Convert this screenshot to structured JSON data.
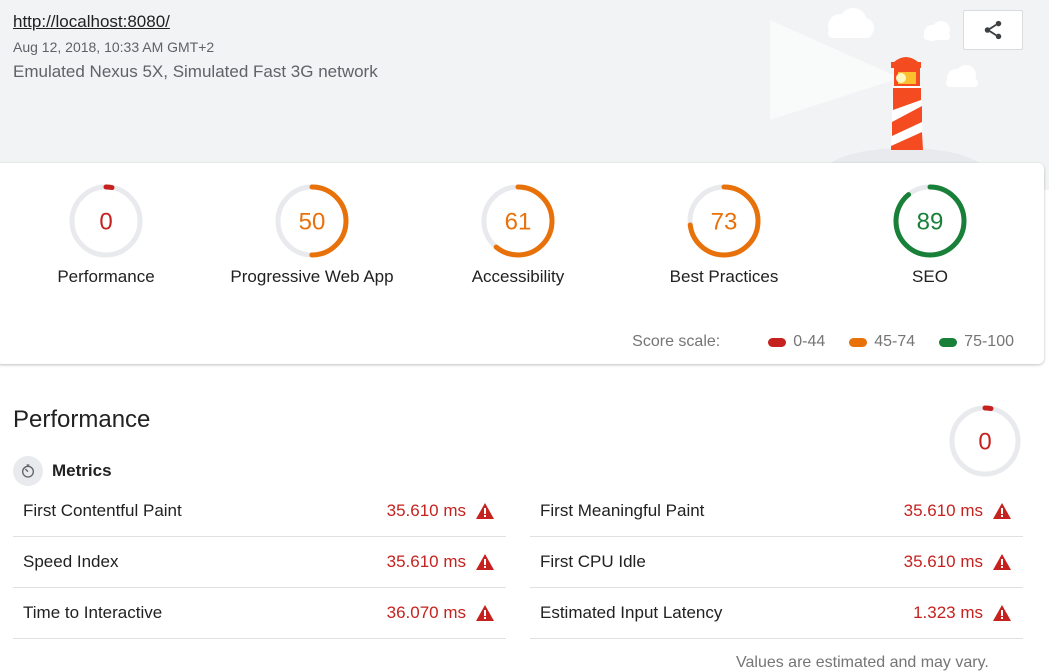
{
  "header": {
    "url": "http://localhost:8080/",
    "timestamp": "Aug 12, 2018, 10:33 AM GMT+2",
    "environment": "Emulated Nexus 5X, Simulated Fast 3G network",
    "share_icon": "share-icon"
  },
  "colors": {
    "fail": "#c5221f",
    "average": "#e8710a",
    "pass": "#188038",
    "track": "#e8eaed"
  },
  "gauges": [
    {
      "label": "Performance",
      "score": "0",
      "fraction": 0.0,
      "rating": "fail"
    },
    {
      "label": "Progressive Web App",
      "score": "50",
      "fraction": 0.5,
      "rating": "average"
    },
    {
      "label": "Accessibility",
      "score": "61",
      "fraction": 0.61,
      "rating": "average"
    },
    {
      "label": "Best Practices",
      "score": "73",
      "fraction": 0.73,
      "rating": "average"
    },
    {
      "label": "SEO",
      "score": "89",
      "fraction": 0.89,
      "rating": "pass"
    }
  ],
  "score_scale": {
    "title": "Score scale:",
    "ranges": [
      {
        "label": "0-44",
        "rating": "fail"
      },
      {
        "label": "45-74",
        "rating": "average"
      },
      {
        "label": "75-100",
        "rating": "pass"
      }
    ]
  },
  "performance": {
    "title": "Performance",
    "score": "0",
    "fraction": 0.0,
    "metrics_label": "Metrics",
    "metrics_icon": "stopwatch-icon",
    "left_metrics": [
      {
        "name": "First Contentful Paint",
        "value": "35.610 ms"
      },
      {
        "name": "Speed Index",
        "value": "35.610 ms"
      },
      {
        "name": "Time to Interactive",
        "value": "36.070 ms"
      }
    ],
    "right_metrics": [
      {
        "name": "First Meaningful Paint",
        "value": "35.610 ms"
      },
      {
        "name": "First CPU Idle",
        "value": "35.610 ms"
      },
      {
        "name": "Estimated Input Latency",
        "value": "1.323 ms"
      }
    ],
    "footnote": "Values are estimated and may vary."
  }
}
